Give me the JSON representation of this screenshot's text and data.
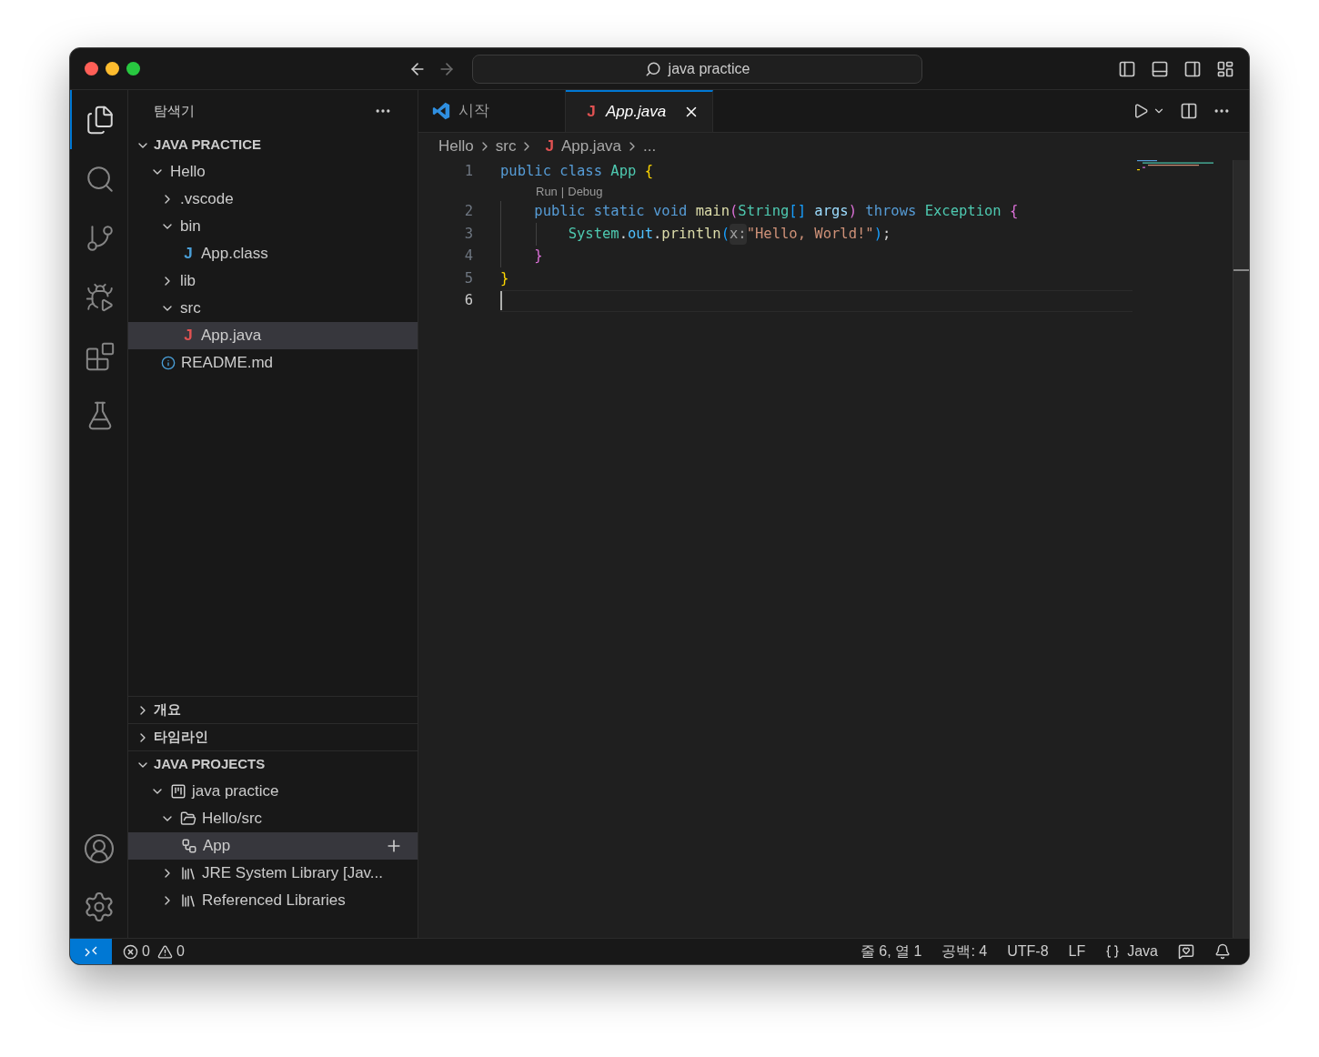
{
  "titlebar": {
    "search": "java practice"
  },
  "activity_bar": [
    {
      "kind": "explorer",
      "selected": true
    },
    {
      "kind": "search",
      "selected": false
    },
    {
      "kind": "source-control",
      "selected": false
    },
    {
      "kind": "run-debug",
      "selected": false
    },
    {
      "kind": "extensions",
      "selected": false
    },
    {
      "kind": "testing",
      "selected": false
    }
  ],
  "sidebar": {
    "title": "탐색기",
    "sections": [
      {
        "title": "JAVA PRACTICE",
        "expanded": true,
        "tree": [
          {
            "label": "Hello",
            "kind": "folder",
            "expanded": true,
            "selected": false,
            "children": [
              {
                "label": ".vscode",
                "kind": "folder",
                "expanded": false,
                "selected": false
              },
              {
                "label": "bin",
                "kind": "folder",
                "expanded": true,
                "selected": false,
                "children": [
                  {
                    "label": "App.class",
                    "kind": "class-file",
                    "icon_text": "J",
                    "selected": false
                  }
                ]
              },
              {
                "label": "lib",
                "kind": "folder",
                "expanded": false,
                "selected": false
              },
              {
                "label": "src",
                "kind": "folder",
                "expanded": true,
                "selected": false,
                "children": [
                  {
                    "label": "App.java",
                    "kind": "java-file",
                    "icon_text": "J",
                    "selected": true
                  }
                ]
              }
            ]
          },
          {
            "label": "README.md",
            "kind": "info-file",
            "selected": false
          }
        ]
      },
      {
        "title": "개요",
        "expanded": false
      },
      {
        "title": "타임라인",
        "expanded": false
      },
      {
        "title": "JAVA PROJECTS",
        "expanded": true,
        "tree": [
          {
            "label": "java practice",
            "kind": "project",
            "expanded": true,
            "selected": false,
            "children": [
              {
                "label": "Hello/src",
                "kind": "package",
                "expanded": true,
                "selected": false,
                "children": [
                  {
                    "label": "App",
                    "kind": "class",
                    "selected": true
                  }
                ]
              },
              {
                "label": "JRE System Library [Jav...",
                "kind": "library",
                "expanded": false,
                "selected": false
              },
              {
                "label": "Referenced Libraries",
                "kind": "library",
                "expanded": false,
                "selected": false
              }
            ]
          }
        ]
      }
    ]
  },
  "tabs": [
    {
      "label": "시작",
      "kind": "welcome",
      "selected": false,
      "preview": false
    },
    {
      "label": "App.java",
      "kind": "java",
      "icon_text": "J",
      "selected": true,
      "preview": true
    }
  ],
  "breadcrumb": [
    {
      "label": "Hello"
    },
    {
      "label": "src"
    },
    {
      "label": "App.java",
      "icon_text": "J"
    },
    {
      "label": "..."
    }
  ],
  "code": [
    {
      "number": "1",
      "current": false,
      "tokens": [
        {
          "text": "public",
          "kind": "keyword"
        },
        {
          "text": " class",
          "kind": "keyword"
        },
        {
          "text": " App",
          "kind": "type"
        },
        {
          "text": " {",
          "kind": "bracket1"
        }
      ],
      "codelens": [
        "Run",
        "|",
        "Debug"
      ]
    },
    {
      "number": "2",
      "current": false,
      "tokens": [
        {
          "text": "    public",
          "kind": "keyword"
        },
        {
          "text": " static",
          "kind": "keyword"
        },
        {
          "text": " void",
          "kind": "keyword"
        },
        {
          "text": " main",
          "kind": "func"
        },
        {
          "text": "(",
          "kind": "bracket2"
        },
        {
          "text": "String",
          "kind": "type"
        },
        {
          "text": "[]",
          "kind": "bracket3"
        },
        {
          "text": " args",
          "kind": "var"
        },
        {
          "text": ")",
          "kind": "bracket2"
        },
        {
          "text": " throws",
          "kind": "keyword"
        },
        {
          "text": " Exception",
          "kind": "type"
        },
        {
          "text": " {",
          "kind": "bracket2"
        }
      ]
    },
    {
      "number": "3",
      "current": false,
      "tokens": [
        {
          "text": "        System",
          "kind": "type"
        },
        {
          "text": ".",
          "kind": "punct"
        },
        {
          "text": "out",
          "kind": "field"
        },
        {
          "text": ".",
          "kind": "punct"
        },
        {
          "text": "println",
          "kind": "func"
        },
        {
          "text": "(",
          "kind": "bracket3"
        },
        {
          "text": "x:",
          "kind": "hint"
        },
        {
          "text": "\"Hello, World!\"",
          "kind": "string"
        },
        {
          "text": ")",
          "kind": "bracket3"
        },
        {
          "text": ";",
          "kind": "punct"
        }
      ]
    },
    {
      "number": "4",
      "current": false,
      "tokens": [
        {
          "text": "    }",
          "kind": "bracket2"
        }
      ]
    },
    {
      "number": "5",
      "current": false,
      "tokens": [
        {
          "text": "}",
          "kind": "bracket1"
        }
      ]
    },
    {
      "number": "6",
      "current": true
    }
  ],
  "status_bar": {
    "errors": "0",
    "warnings": "0",
    "position": "줄 6, 열 1",
    "indent": "공백: 4",
    "encoding": "UTF-8",
    "eol": "LF",
    "language": "Java"
  }
}
